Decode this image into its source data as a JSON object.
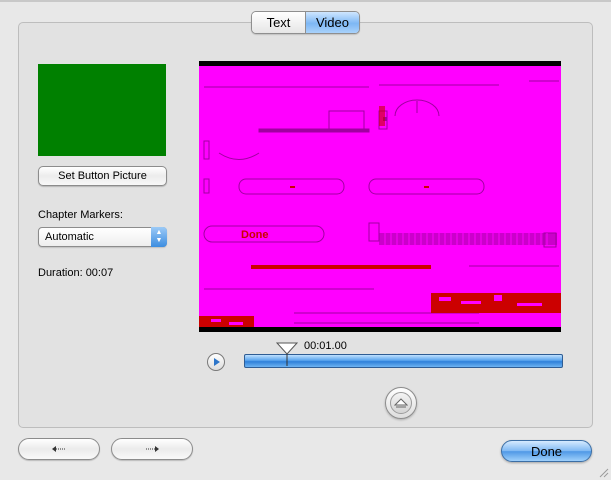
{
  "tabs": [
    {
      "label": "Text",
      "selected": false
    },
    {
      "label": "Video",
      "selected": true
    }
  ],
  "left_panel": {
    "thumbnail_color": "#008000",
    "set_picture_button": "Set Button Picture",
    "chapter_markers_label": "Chapter Markers:",
    "chapter_markers_value": "Automatic",
    "duration_label": "Duration: 00:07"
  },
  "player": {
    "timecode": "00:01.00",
    "video_background": "#ff00ff",
    "video_garbled_text": {
      "done": "Done"
    }
  },
  "bottom": {
    "prev_icon": "left-arrow-icon",
    "next_icon": "right-arrow-icon",
    "done_label": "Done"
  },
  "colors": {
    "accent": "#5aa5ee",
    "magenta": "#ff00ff",
    "artifact_red": "#cc0000"
  }
}
